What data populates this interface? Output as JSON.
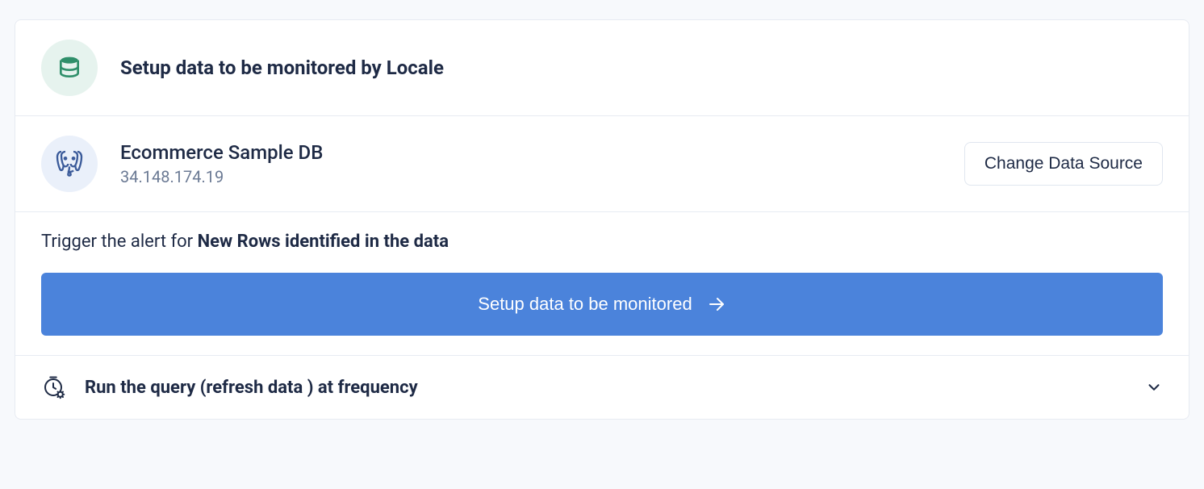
{
  "header": {
    "title": "Setup data to be monitored by Locale"
  },
  "datasource": {
    "name": "Ecommerce Sample DB",
    "host": "34.148.174.19",
    "change_label": "Change Data Source"
  },
  "trigger": {
    "prefix": "Trigger the alert for ",
    "strong": "New Rows identified in the data",
    "button_label": "Setup data to be monitored"
  },
  "frequency": {
    "label": "Run the query (refresh data ) at frequency"
  }
}
